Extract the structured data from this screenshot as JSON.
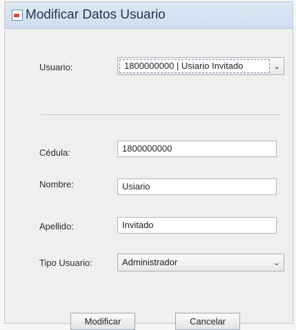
{
  "window": {
    "title": "Modificar Datos Usuario"
  },
  "form": {
    "usuario_label": "Usuario:",
    "usuario_selected": "1800000000 | Usiario Invitado",
    "cedula_label": "Cédula:",
    "cedula_value": "1800000000",
    "nombre_label": "Nombre:",
    "nombre_value": "Usiario",
    "apellido_label": "Apellido:",
    "apellido_value": "Invitado",
    "tipo_label": "Tipo Usuario:",
    "tipo_selected": "Administrador"
  },
  "buttons": {
    "modify": "Modificar",
    "cancel": "Cancelar"
  }
}
